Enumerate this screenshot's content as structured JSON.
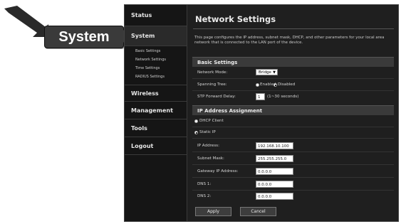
{
  "callout": {
    "label": "System"
  },
  "sidebar": {
    "items": [
      {
        "label": "Status"
      },
      {
        "label": "System"
      },
      {
        "label": "Wireless"
      },
      {
        "label": "Management"
      },
      {
        "label": "Tools"
      },
      {
        "label": "Logout"
      }
    ],
    "system_subitems": [
      {
        "label": "Basic Settings"
      },
      {
        "label": "Network Settings"
      },
      {
        "label": "Time Settings"
      },
      {
        "label": "RADIUS Settings"
      }
    ]
  },
  "page": {
    "title": "Network Settings",
    "description": "This page configures the IP address, subnet mask, DHCP, and other parameters for your local area network that is connected to the LAN port of the device."
  },
  "basic_settings": {
    "heading": "Basic Settings",
    "network_mode_label": "Network Mode:",
    "network_mode_value": "Bridge",
    "spanning_tree_label": "Spanning Tree:",
    "spanning_enabled_label": "Enabled",
    "spanning_disabled_label": "Disabled",
    "spanning_tree_value": "Disabled",
    "stp_delay_label": "STP Forward Delay:",
    "stp_delay_value": "1",
    "stp_delay_hint": "(1~30 seconds)"
  },
  "ip_assignment": {
    "heading": "IP Address Assignment",
    "dhcp_label": "DHCP Client",
    "static_label": "Static IP",
    "selected": "Static IP",
    "ip_label": "IP Address:",
    "ip_value": "192.168.10.100",
    "mask_label": "Subnet Mask:",
    "mask_value": "255.255.255.0",
    "gateway_label": "Gateway IP Address:",
    "gateway_value": "0.0.0.0",
    "dns1_label": "DNS 1:",
    "dns1_value": "0.0.0.0",
    "dns2_label": "DNS 2:",
    "dns2_value": "0.0.0.0"
  },
  "buttons": {
    "apply": "Apply",
    "cancel": "Cancel"
  }
}
